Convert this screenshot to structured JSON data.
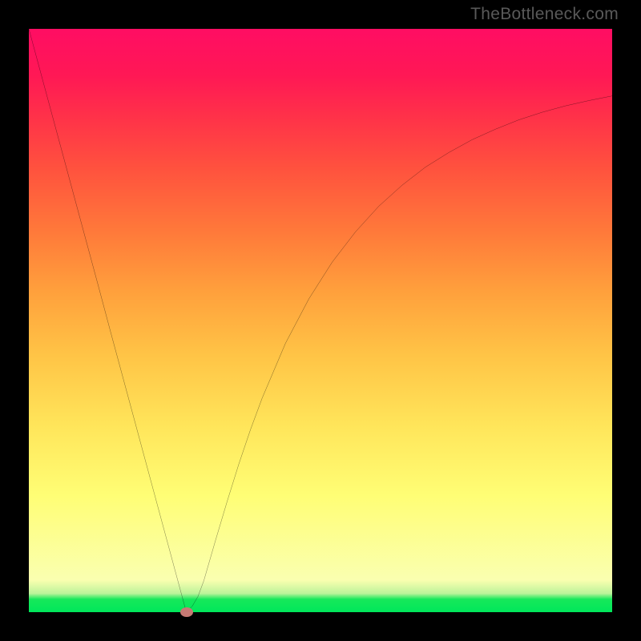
{
  "watermark": "TheBottleneck.com",
  "chart_data": {
    "type": "line",
    "title": "",
    "xlabel": "",
    "ylabel": "",
    "xlim": [
      0,
      100
    ],
    "ylim": [
      0,
      100
    ],
    "grid": false,
    "x": [
      0,
      2,
      4,
      6,
      8,
      10,
      12,
      14,
      16,
      18,
      20,
      22,
      24,
      26,
      27,
      28,
      29,
      30,
      32,
      34,
      36,
      38,
      40,
      44,
      48,
      52,
      56,
      60,
      64,
      68,
      72,
      76,
      80,
      84,
      88,
      92,
      96,
      100
    ],
    "y": [
      100,
      92.6,
      85.2,
      77.8,
      70.4,
      63.0,
      55.6,
      48.1,
      40.7,
      33.3,
      25.9,
      18.5,
      11.1,
      3.7,
      0.0,
      1.0,
      2.7,
      5.4,
      12.3,
      19.0,
      25.4,
      31.3,
      36.7,
      46.1,
      53.7,
      60.0,
      65.2,
      69.6,
      73.2,
      76.3,
      78.8,
      81.0,
      82.8,
      84.4,
      85.7,
      86.8,
      87.7,
      88.5
    ],
    "min_marker": {
      "x": 27,
      "y": 0
    },
    "line_color": "#000000",
    "marker_color": "#c77a74",
    "background": "gradient-red-yellow-green"
  }
}
